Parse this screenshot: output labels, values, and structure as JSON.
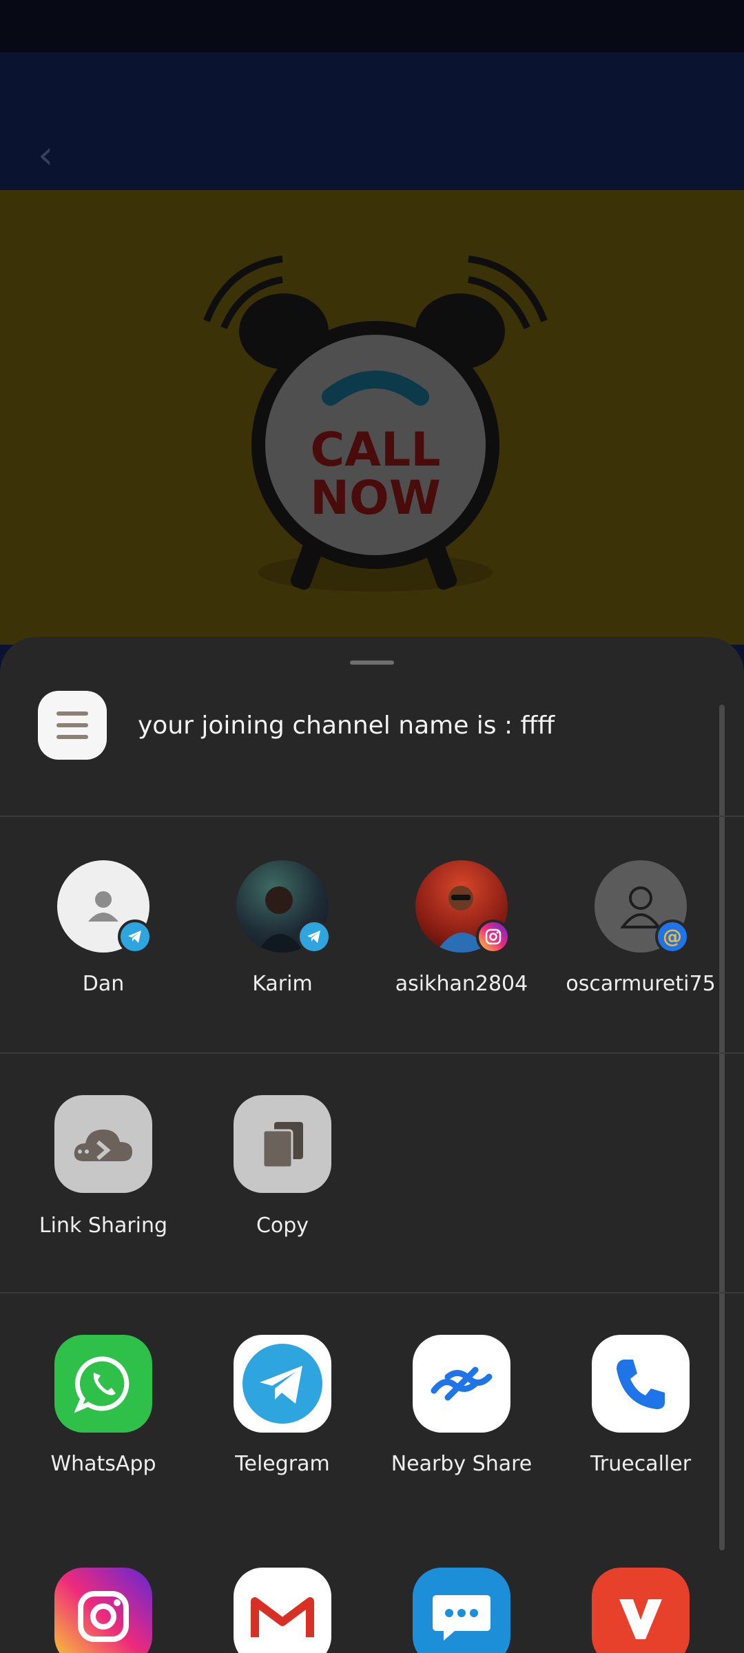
{
  "hero": {
    "line1": "CALL",
    "line2": "NOW"
  },
  "share": {
    "preview_text": "your joining channel name is : ffff",
    "contacts": [
      {
        "name": "Dan",
        "badge": "telegram-icon"
      },
      {
        "name": "Karim",
        "badge": "telegram-icon"
      },
      {
        "name": "asikhan2804",
        "badge": "instagram-icon"
      },
      {
        "name": "oscarmureti75",
        "badge": "email-icon"
      }
    ],
    "actions": [
      {
        "label": "Link Sharing",
        "icon": "cloud-link-icon"
      },
      {
        "label": "Copy",
        "icon": "copy-icon"
      }
    ],
    "apps": [
      {
        "label": "WhatsApp",
        "icon": "whatsapp-icon"
      },
      {
        "label": "Telegram",
        "icon": "telegram-icon"
      },
      {
        "label": "Nearby Share",
        "icon": "nearby-share-icon"
      },
      {
        "label": "Truecaller",
        "icon": "truecaller-icon"
      }
    ],
    "apps_row2": [
      {
        "icon": "instagram-icon"
      },
      {
        "icon": "gmail-icon"
      },
      {
        "icon": "messages-icon"
      },
      {
        "icon": "vidmate-icon"
      }
    ]
  },
  "colors": {
    "sheet": "#272727",
    "whatsapp": "#2fc04a",
    "telegram": "#2ea5df",
    "accent_blue": "#1f74e8"
  }
}
